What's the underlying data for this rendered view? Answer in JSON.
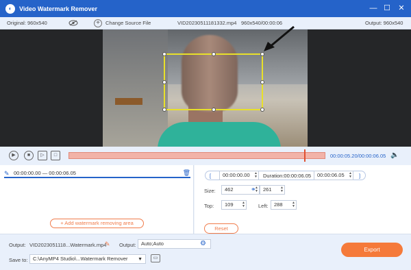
{
  "app": {
    "title": "Video Watermark Remover"
  },
  "window": {
    "minimize": "—",
    "maximize": "☐",
    "close": "✕"
  },
  "infobar": {
    "original": "Original: 960x540",
    "change_source": "Change Source File",
    "filename": "VID20230511181332.mp4",
    "resolution_duration": "960x540/00:00:06",
    "output": "Output: 960x540"
  },
  "player": {
    "time_display": "00:00:05.20/00:00:06.05"
  },
  "segment": {
    "range": "00:00:00.00 — 00:00:06.05"
  },
  "add_area_label": "Add watermark removing area",
  "trim": {
    "start": "00:00:00.00",
    "duration": "Duration:00:00:06.05",
    "end": "00:00:06.05"
  },
  "size": {
    "label": "Size:",
    "width": "462",
    "height": "261"
  },
  "position": {
    "top_label": "Top:",
    "top": "109",
    "left_label": "Left:",
    "left": "288"
  },
  "reset_label": "Reset",
  "output_bar": {
    "output_label": "Output:",
    "output_file": "VID2023051118...Watermark.mp4",
    "format_label": "Output:",
    "format_value": "Auto;Auto",
    "saveto_label": "Save to:",
    "saveto_value": "C:\\AnyMP4 Studio\\...Watermark Remover",
    "export_label": "Export"
  },
  "colors": {
    "accent": "#2563c9",
    "orange": "#f57a3a",
    "selection": "#e8e02a"
  }
}
